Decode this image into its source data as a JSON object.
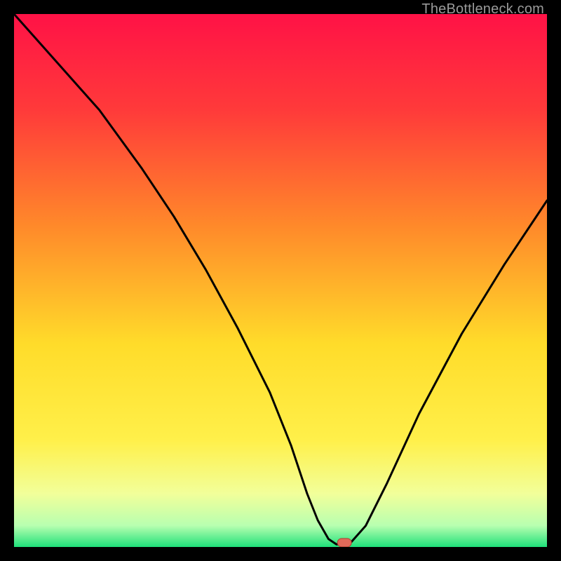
{
  "watermark": "TheBottleneck.com",
  "colors": {
    "background_black": "#000000",
    "gradient_top": "#ff1246",
    "gradient_mid1": "#ff7a2a",
    "gradient_mid2": "#ffdc2a",
    "gradient_low": "#f6ff8a",
    "gradient_bottom": "#1fe07a",
    "curve": "#000000",
    "marker_fill": "#e06a5a",
    "marker_stroke": "#b04030"
  },
  "chart_data": {
    "type": "line",
    "title": "",
    "xlabel": "",
    "ylabel": "",
    "xlim": [
      0,
      100
    ],
    "ylim": [
      0,
      100
    ],
    "grid": false,
    "legend": null,
    "series": [
      {
        "name": "bottleneck-curve",
        "x": [
          0,
          8,
          16,
          24,
          30,
          36,
          42,
          48,
          52,
          55,
          57,
          59,
          60.5,
          63,
          66,
          70,
          76,
          84,
          92,
          100
        ],
        "y": [
          100,
          91,
          82,
          71,
          62,
          52,
          41,
          29,
          19,
          10,
          5,
          1.5,
          0.5,
          0.6,
          4,
          12,
          25,
          40,
          53,
          65
        ]
      }
    ],
    "flat_segment": {
      "x_start": 55,
      "x_end": 63,
      "y": 0.6
    },
    "marker": {
      "x": 62,
      "y": 0.8,
      "shape": "rounded-rect"
    }
  }
}
